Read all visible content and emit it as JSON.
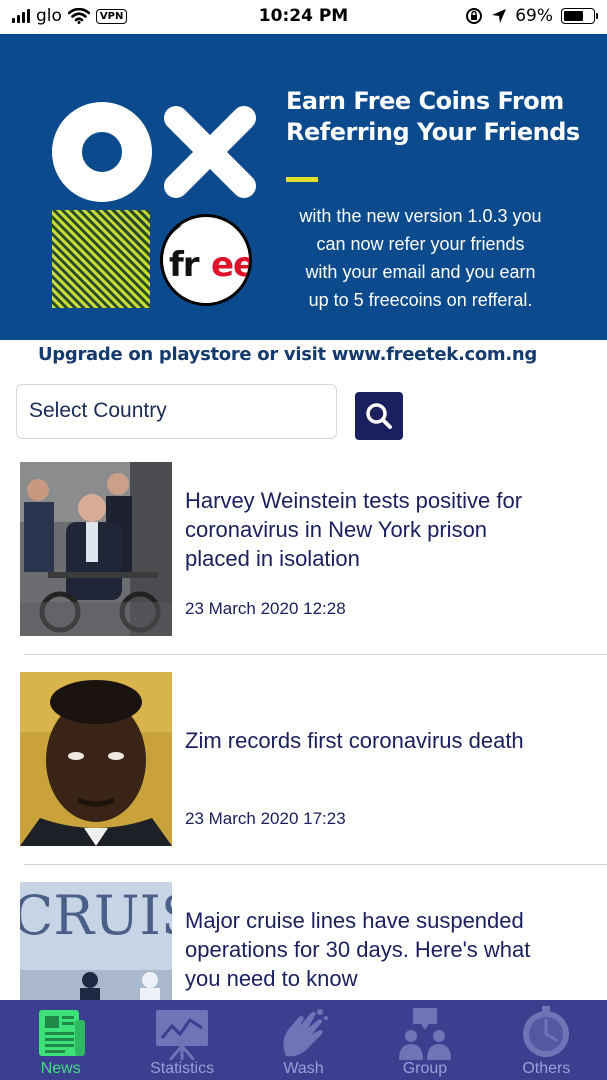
{
  "status_bar": {
    "carrier": "glo",
    "vpn": "VPN",
    "time": "10:24 PM",
    "battery": "69%",
    "battery_level": 0.69
  },
  "banner": {
    "title_line1": "Earn Free Coins From",
    "title_line2": "Referring Your Friends",
    "body_line1": "with the new version 1.0.3 you",
    "body_line2": "can now refer your friends",
    "body_line3": "with your email and  you earn",
    "body_line4": "up to 5 freecoins on refferal.",
    "logo_fr": "fr",
    "logo_ee": "ee",
    "bg_color": "#0b4a8c",
    "accent_color": "#e6e02a"
  },
  "upgrade": "Upgrade on playstore or visit www.freetek.com.ng",
  "search": {
    "select_label": "Select Country",
    "button_icon": "search-icon"
  },
  "news": [
    {
      "title_line1": "Harvey Weinstein tests positive for",
      "title_line2": "coronavirus in New York prison",
      "title_line3": "placed in isolation",
      "date": "23 March 2020 12:28"
    },
    {
      "title_line1": "Zim records first coronavirus death",
      "date": "23 March 2020 17:23"
    },
    {
      "title_line1": "Major cruise lines have suspended",
      "title_line2": "operations for 30 days. Here's what",
      "title_line3": "you need to know",
      "thumb_text": "CRUISE"
    }
  ],
  "tabs": [
    {
      "label": "News",
      "icon": "newspaper-icon",
      "active": true
    },
    {
      "label": "Statistics",
      "icon": "chart-board-icon",
      "active": false
    },
    {
      "label": "Wash",
      "icon": "hand-wash-icon",
      "active": false
    },
    {
      "label": "Group",
      "icon": "group-icon",
      "active": false
    },
    {
      "label": "Others",
      "icon": "stopwatch-icon",
      "active": false
    }
  ],
  "colors": {
    "tab_bar": "#3a3f8f",
    "tab_active": "#3ee07a",
    "text_primary": "#1a1f5e"
  }
}
